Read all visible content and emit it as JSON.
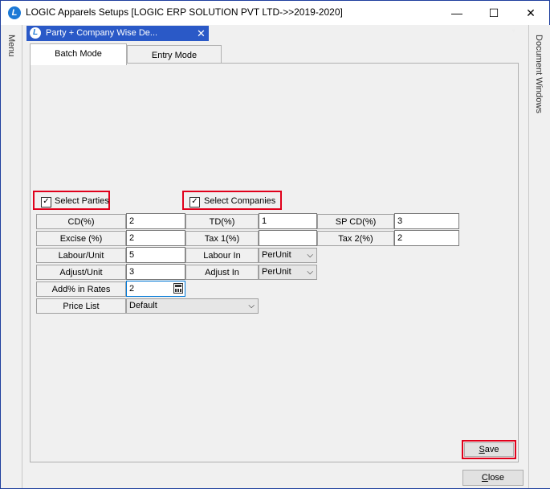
{
  "window": {
    "title": "LOGIC Apparels Setups  [LOGIC ERP SOLUTION PVT LTD->>2019-2020]",
    "minimize": "—",
    "maximize": "☐",
    "close": "✕"
  },
  "sidebar": {
    "left_label": "Menu",
    "right_label": "Document Windows"
  },
  "doc_tab": {
    "label": "Party + Company Wise De...",
    "close": "✕"
  },
  "tabs": [
    {
      "label": "Batch Mode"
    },
    {
      "label": "Entry Mode"
    }
  ],
  "select_parties": {
    "label": "Select Parties",
    "checked": true,
    "mark": "✓"
  },
  "select_companies": {
    "label": "Select Companies",
    "checked": true,
    "mark": "✓"
  },
  "form": {
    "cd": {
      "label": "CD(%)",
      "value": "2"
    },
    "td": {
      "label": "TD(%)",
      "value": "1"
    },
    "sp_cd": {
      "label": "SP CD(%)",
      "value": "3"
    },
    "excise": {
      "label": "Excise (%)",
      "value": "2"
    },
    "tax1": {
      "label": "Tax 1(%)",
      "value": ""
    },
    "tax2": {
      "label": "Tax 2(%)",
      "value": "2"
    },
    "labour_unit": {
      "label": "Labour/Unit",
      "value": "5"
    },
    "labour_in": {
      "label": "Labour In",
      "value": "PerUnit"
    },
    "adjust_unit": {
      "label": "Adjust/Unit",
      "value": "3"
    },
    "adjust_in": {
      "label": "Adjust In",
      "value": "PerUnit"
    },
    "add_rates": {
      "label": "Add% in Rates",
      "value": "2"
    },
    "price_list": {
      "label": "Price List",
      "value": "Default"
    }
  },
  "buttons": {
    "save_first": "S",
    "save_rest": "ave",
    "close_first": "C",
    "close_rest": "lose"
  },
  "dropdown_arrow": "⌵"
}
